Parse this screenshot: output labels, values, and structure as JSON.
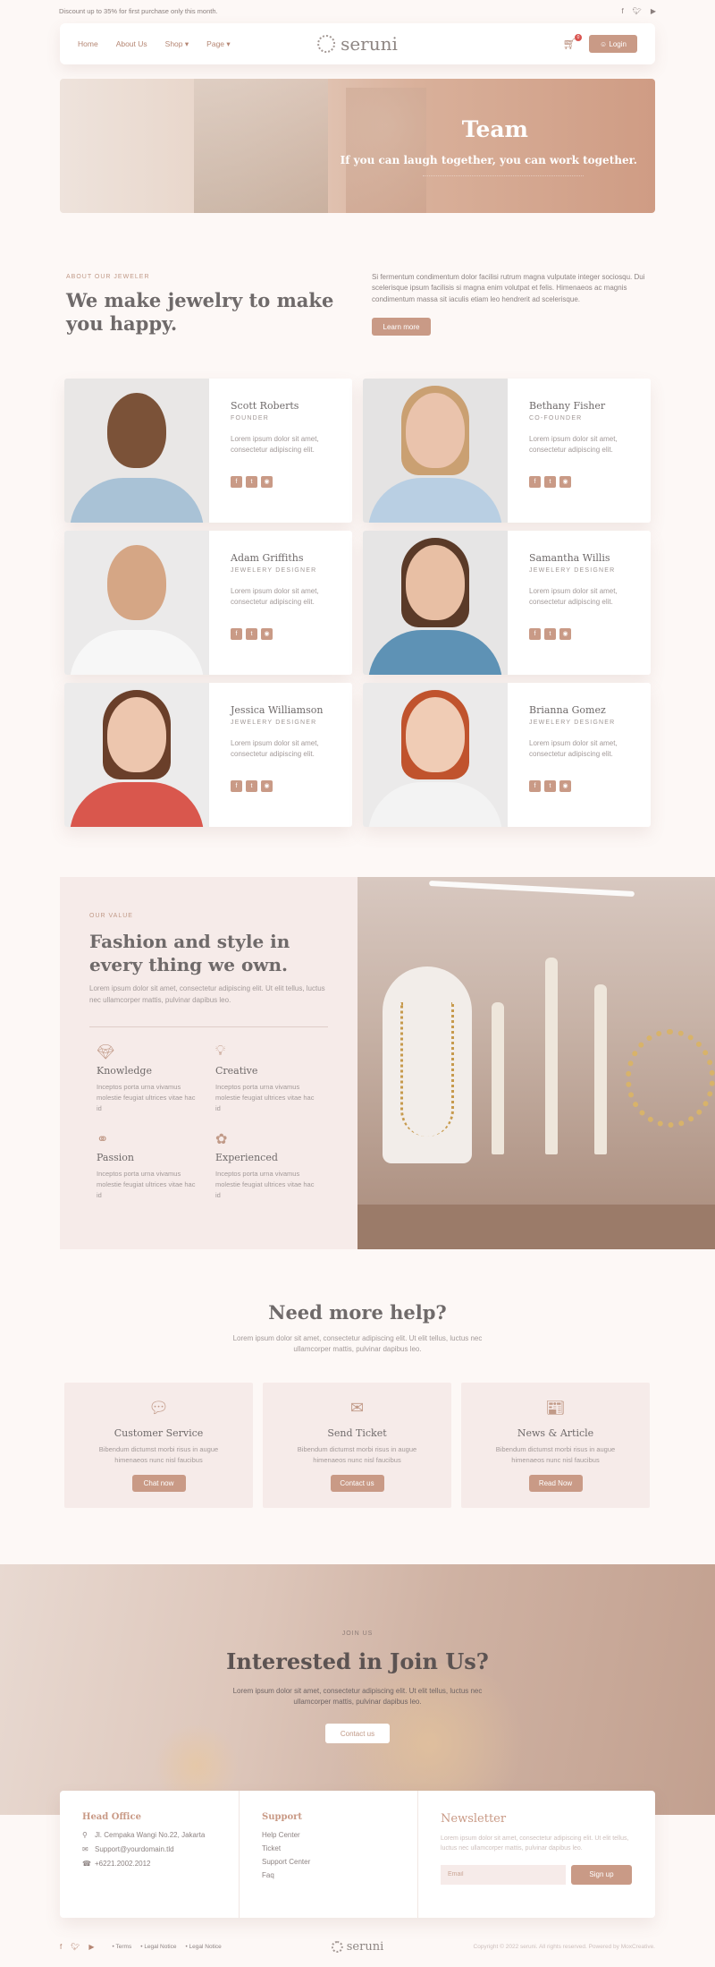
{
  "topbar": {
    "promo": "Discount up to 35% for first purchase only this month."
  },
  "nav": {
    "links": [
      "Home",
      "About Us",
      "Shop",
      "Page"
    ],
    "logo": "seruni",
    "cart_count": "0",
    "login": "Login"
  },
  "hero": {
    "title": "Team",
    "subtitle": "If you can laugh together, you can work together."
  },
  "about": {
    "eyebrow": "ABOUT OUR JEWELER",
    "heading": "We make jewelry to make you happy.",
    "body": "Si fermentum condimentum dolor facilisi rutrum magna vulputate integer sociosqu. Dui scelerisque ipsum facilisis si magna enim volutpat et felis. Himenaeos ac magnis condimentum massa sit iaculis etiam leo hendrerit ad scelerisque.",
    "button": "Learn more"
  },
  "team": [
    {
      "name": "Scott Roberts",
      "role": "FOUNDER",
      "desc": "Lorem ipsum dolor sit amet, consectetur adipiscing elit."
    },
    {
      "name": "Bethany Fisher",
      "role": "CO-FOUNDER",
      "desc": "Lorem ipsum dolor sit amet, consectetur adipiscing elit."
    },
    {
      "name": "Adam Griffiths",
      "role": "JEWELERY DESIGNER",
      "desc": "Lorem ipsum dolor sit amet, consectetur adipiscing elit."
    },
    {
      "name": "Samantha Willis",
      "role": "JEWELERY DESIGNER",
      "desc": "Lorem ipsum dolor sit amet, consectetur adipiscing elit."
    },
    {
      "name": "Jessica Williamson",
      "role": "JEWELERY DESIGNER",
      "desc": "Lorem ipsum dolor sit amet, consectetur adipiscing elit."
    },
    {
      "name": "Brianna Gomez",
      "role": "JEWELERY DESIGNER",
      "desc": "Lorem ipsum dolor sit amet, consectetur adipiscing elit."
    }
  ],
  "value": {
    "eyebrow": "OUR VALUE",
    "heading": "Fashion and style in every thing we own.",
    "lead": "Lorem ipsum dolor sit amet, consectetur adipiscing elit. Ut elit tellus, luctus nec ullamcorper mattis, pulvinar dapibus leo.",
    "items": [
      {
        "title": "Knowledge",
        "text": "Inceptos porta urna vivamus molestie feugiat ultrices vitae hac id"
      },
      {
        "title": "Creative",
        "text": "Inceptos porta urna vivamus molestie feugiat ultrices vitae hac id"
      },
      {
        "title": "Passion",
        "text": "Inceptos porta urna vivamus molestie feugiat ultrices vitae hac id"
      },
      {
        "title": "Experienced",
        "text": "Inceptos porta urna vivamus molestie feugiat ultrices vitae hac id"
      }
    ]
  },
  "help": {
    "title": "Need more help?",
    "sub": "Lorem ipsum dolor sit amet, consectetur adipiscing elit. Ut elit tellus, luctus nec ullamcorper mattis, pulvinar dapibus leo.",
    "cards": [
      {
        "title": "Customer Service",
        "text": "Bibendum dictumst morbi risus in augue himenaeos nunc nisl faucibus",
        "button": "Chat now"
      },
      {
        "title": "Send Ticket",
        "text": "Bibendum dictumst morbi risus in augue himenaeos nunc nisl faucibus",
        "button": "Contact us"
      },
      {
        "title": "News & Article",
        "text": "Bibendum dictumst morbi risus in augue himenaeos nunc nisl faucibus",
        "button": "Read Now"
      }
    ]
  },
  "join": {
    "eyebrow": "JOIN US",
    "heading": "Interested in Join Us?",
    "text": "Lorem ipsum dolor sit amet, consectetur adipiscing elit. Ut elit tellus, luctus nec ullamcorper mattis, pulvinar dapibus leo.",
    "button": "Contact us"
  },
  "footer": {
    "office_title": "Head Office",
    "address": "Jl. Cempaka Wangi No.22, Jakarta",
    "email": "Support@yourdomain.tld",
    "phone": "+6221.2002.2012",
    "support_title": "Support",
    "support_links": [
      "Help Center",
      "Ticket",
      "Support Center",
      "Faq"
    ],
    "news_title": "Newsletter",
    "news_text": "Lorem ipsum dolor sit amet, consectetur adipiscing elit. Ut elit tellus, luctus nec ullamcorper mattis, pulvinar dapibus leo.",
    "email_placeholder": "Email",
    "signup": "Sign up"
  },
  "bottom": {
    "links": [
      "Terms",
      "Legal Notice",
      "Legal Notice"
    ],
    "logo": "seruni",
    "copyright": "Copyright © 2022 seruni. All rights reserved. Powered by MoxCreative."
  },
  "colors": {
    "accent": "#c99a86",
    "text": "#6f6a6a",
    "panel": "#f6ebe9"
  }
}
